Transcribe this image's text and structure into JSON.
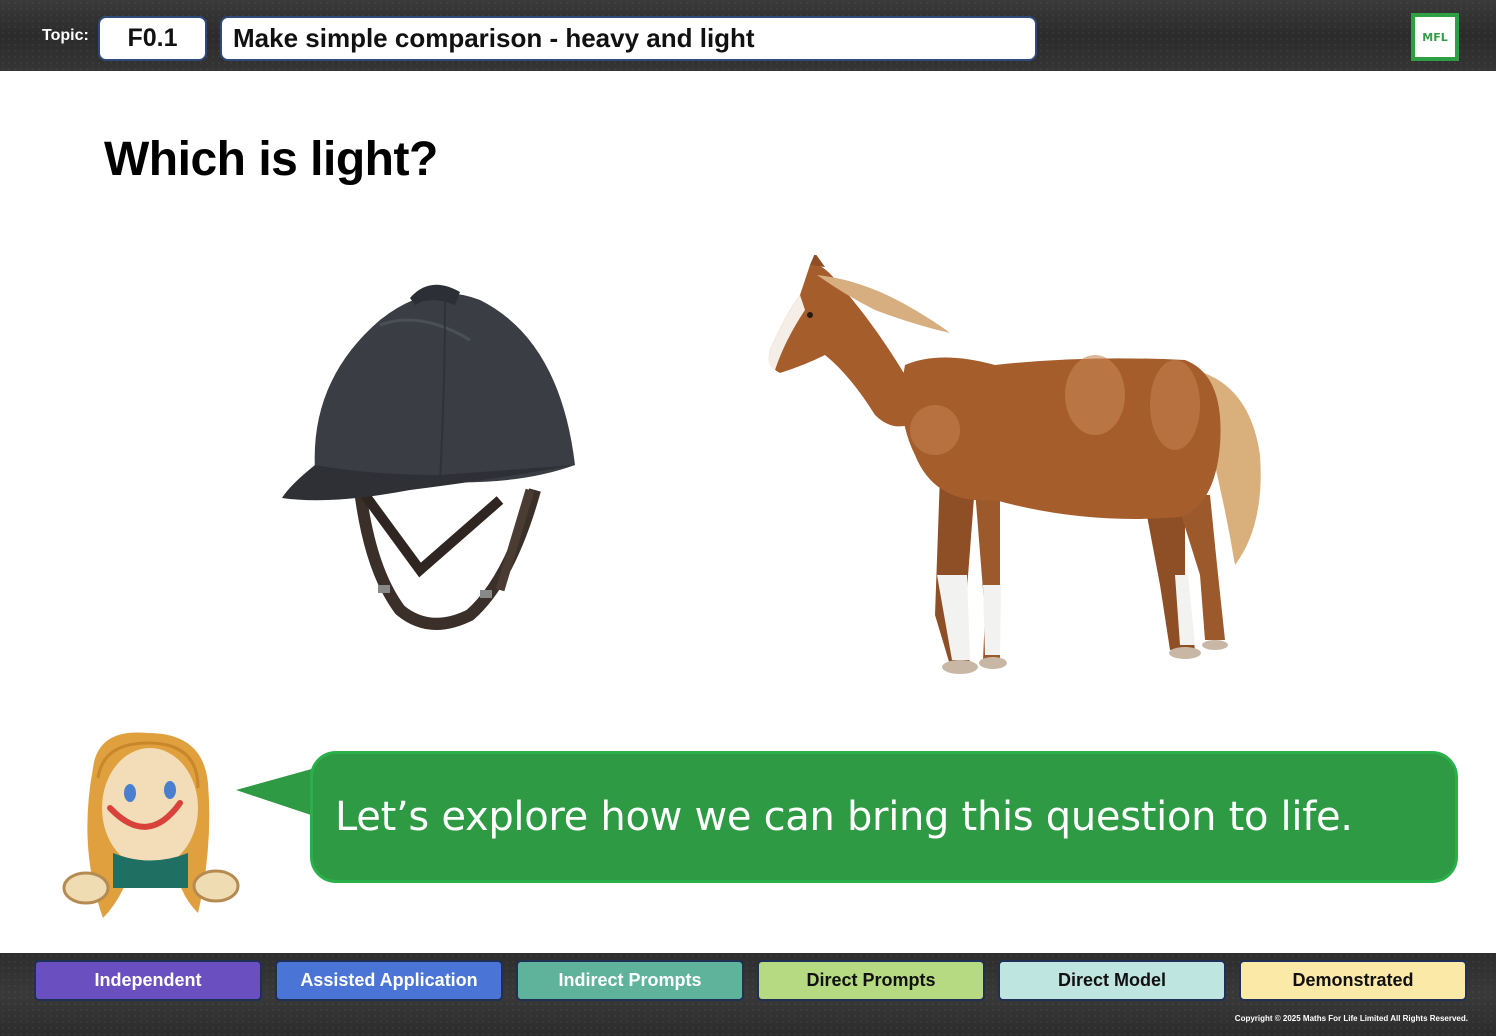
{
  "header": {
    "topic_label": "Topic:",
    "topic_code": "F0.1",
    "topic_title": "Make simple comparison - heavy and light",
    "logo_text": "MFL"
  },
  "question": "Which is light?",
  "items": [
    {
      "name": "riding helmet"
    },
    {
      "name": "horse"
    }
  ],
  "speech_bubble": {
    "text": "Let’s explore how we can bring this question to life.",
    "color": "#2f9a44"
  },
  "levels": [
    {
      "label": "Independent",
      "color": "#6a4fc1",
      "text_color": "#ffffff"
    },
    {
      "label": "Assisted Application",
      "color": "#4a74d6",
      "text_color": "#ffffff"
    },
    {
      "label": "Indirect Prompts",
      "color": "#5fb39a",
      "text_color": "#ffffff"
    },
    {
      "label": "Direct Prompts",
      "color": "#b6da82",
      "text_color": "#111111"
    },
    {
      "label": "Direct Model",
      "color": "#bfe5e0",
      "text_color": "#111111"
    },
    {
      "label": "Demonstrated",
      "color": "#fbe9a8",
      "text_color": "#111111"
    }
  ],
  "copyright": "Copyright © 2025 Maths For Life Limited All Rights Reserved."
}
